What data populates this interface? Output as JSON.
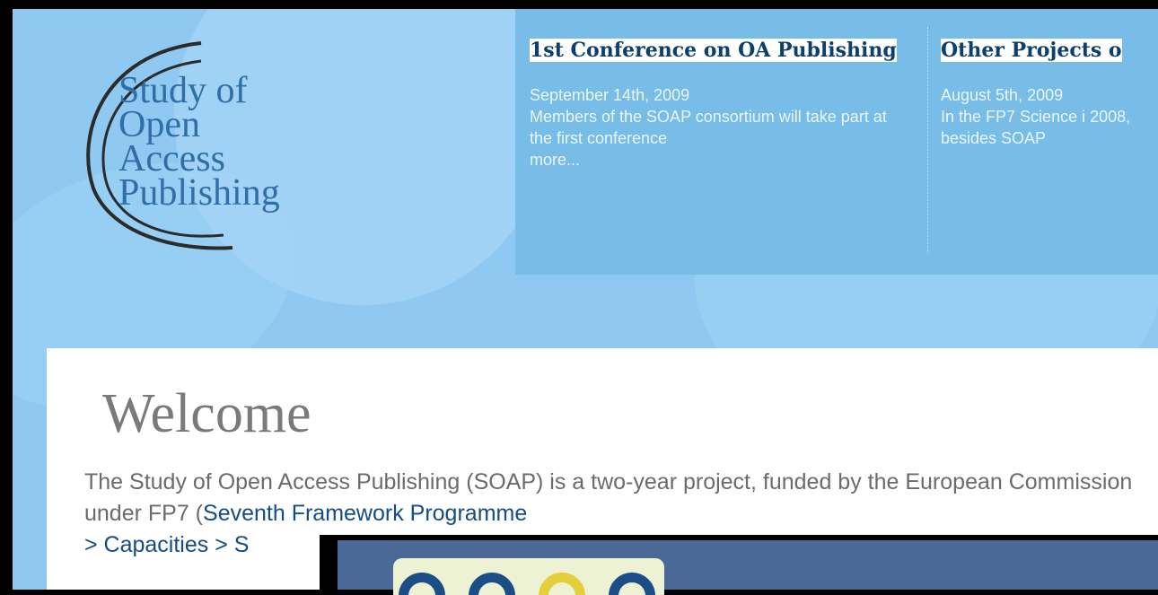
{
  "logo": {
    "lines": [
      "Study of",
      "Open",
      "Access",
      "Publishing"
    ]
  },
  "news": [
    {
      "title": "1st Conference on OA Publishing",
      "date": "September 14th, 2009",
      "text": "Members of the SOAP consortium will take part at the first conference",
      "more": "more..."
    },
    {
      "title": "Other Projects o",
      "date": "August 5th, 2009",
      "text": "In the FP7 Science i 2008, besides SOAP"
    }
  ],
  "welcome": {
    "heading": "Welcome",
    "intro_start": "The Study of Open Access Publishing (SOAP) is a two-year project, funded by the European Commission under FP7 (",
    "link1": "Seventh Framework Programme",
    "link2": "> Capacities > S"
  },
  "colors": {
    "header_bg": "#8fc9f1",
    "news_bg": "#77bde8",
    "link": "#134d86",
    "popup_bar": "#4a6997"
  }
}
